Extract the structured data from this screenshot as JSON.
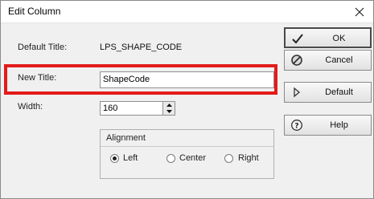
{
  "window": {
    "title": "Edit Column"
  },
  "fields": {
    "default_title": {
      "label": "Default Title:",
      "value": "LPS_SHAPE_CODE"
    },
    "new_title": {
      "label": "New Title:",
      "value": "ShapeCode"
    },
    "width": {
      "label": "Width:",
      "value": "160"
    }
  },
  "alignment": {
    "label": "Alignment",
    "options": [
      "Left",
      "Center",
      "Right"
    ],
    "selected": "Left"
  },
  "buttons": {
    "ok": "OK",
    "cancel": "Cancel",
    "default": "Default",
    "help": "Help"
  },
  "colors": {
    "highlight": "#e31b1b"
  },
  "icons": [
    "close-icon",
    "checkmark-icon",
    "cancel-icon",
    "play-arrow-icon",
    "help-icon",
    "spin-up-icon",
    "spin-down-icon"
  ]
}
